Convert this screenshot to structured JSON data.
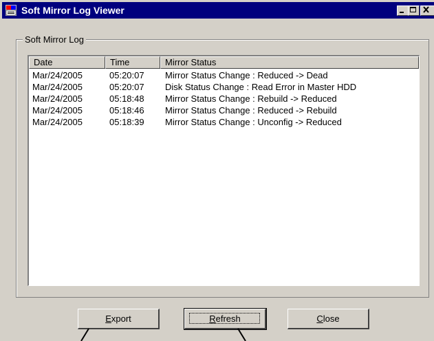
{
  "window": {
    "title": "Soft Mirror Log Viewer",
    "icon": "app-window-icon",
    "controls": [
      "minimize-icon",
      "maximize-icon",
      "close-icon"
    ]
  },
  "group": {
    "label": "Soft Mirror Log"
  },
  "log_table": {
    "columns": [
      "Date",
      "Time",
      "Mirror Status"
    ],
    "rows": [
      [
        "Mar/24/2005",
        "05:20:07",
        "Mirror Status Change : Reduced -> Dead"
      ],
      [
        "Mar/24/2005",
        "05:20:07",
        "Disk Status Change : Read Error in Master HDD"
      ],
      [
        "Mar/24/2005",
        "05:18:48",
        "Mirror Status Change : Rebuild -> Reduced"
      ],
      [
        "Mar/24/2005",
        "05:18:46",
        "Mirror Status Change : Reduced -> Rebuild"
      ],
      [
        "Mar/24/2005",
        "05:18:39",
        "Mirror Status Change : Unconfig -> Reduced"
      ]
    ]
  },
  "buttons": {
    "export": {
      "mn": "E",
      "rest": "xport"
    },
    "refresh": {
      "mn": "R",
      "rest": "efresh"
    },
    "close": {
      "mn": "C",
      "rest": "lose"
    }
  },
  "colors": {
    "titlebar": "#00007e",
    "face": "#d4d0c8"
  }
}
